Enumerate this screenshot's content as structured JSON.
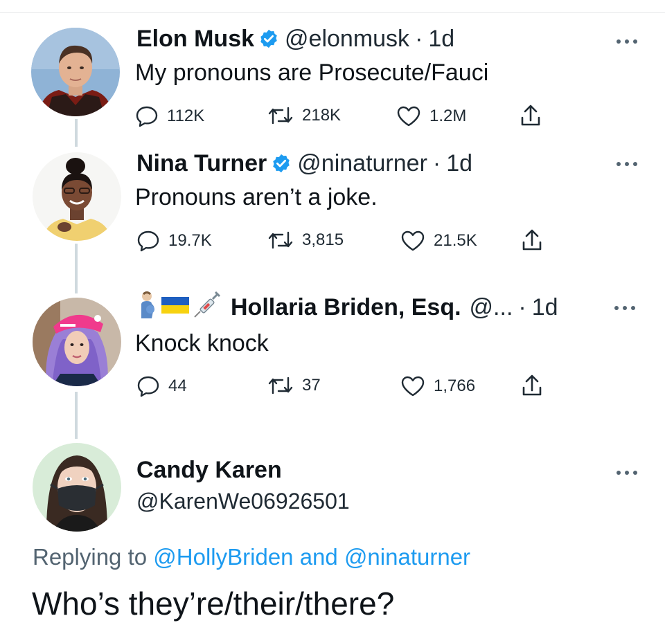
{
  "tweets": [
    {
      "name": "Elon Musk",
      "handle": "@elonmusk",
      "separator": "·",
      "time": "1d",
      "text": "My pronouns are Prosecute/Fauci",
      "replies": "112K",
      "retweets": "218K",
      "likes": "1.2M"
    },
    {
      "name": "Nina Turner",
      "handle": "@ninaturner",
      "separator": "·",
      "time": "1d",
      "text": "Pronouns aren’t a joke.",
      "replies": "19.7K",
      "retweets": "3,815",
      "likes": "21.5K"
    },
    {
      "name": "Hollaria Briden, Esq.",
      "handle": "@...",
      "separator": "·",
      "time": "1d",
      "text": "Knock knock",
      "replies": "44",
      "retweets": "37",
      "likes": "1,766",
      "name_emojis": [
        "pregnant-man-emoji",
        "ukraine-flag-emoji",
        "syringe-emoji"
      ]
    }
  ],
  "reply": {
    "name": "Candy Karen",
    "handle": "@KarenWe06926501",
    "replying_prefix": "Replying to",
    "mention_1": "@HollyBriden",
    "and_word": "and",
    "mention_2": "@ninaturner",
    "text": "Who’s they’re/their/there?"
  },
  "icons": {
    "reply": "reply-bubble-icon",
    "retweet": "retweet-icon",
    "like": "heart-icon",
    "share": "share-icon",
    "more": "more-dots-icon",
    "verified": "verified-badge-icon"
  },
  "colors": {
    "verified_blue": "#1d9bf0",
    "text": "#0f1419",
    "secondary": "#536471",
    "mention": "#1d9bf0",
    "thread_line": "#cfd9de"
  }
}
